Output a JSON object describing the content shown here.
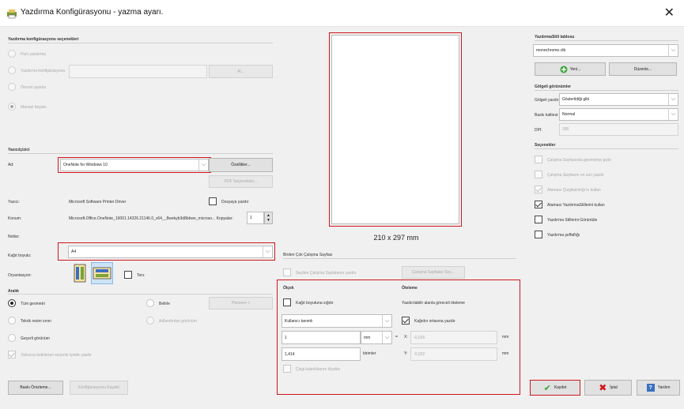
{
  "window": {
    "title": "Yazdırma Konfigürasyonu - yazma ayarı.",
    "close": "✕"
  },
  "config_section": {
    "title": "Yazdırma konfigürasyonu seçenekleri",
    "options": [
      "Hızlı yazdırma",
      "Yazdırma konfigürasyonu",
      "Önceki ayarlar",
      "Manuel beyanı"
    ],
    "selected": "Manuel beyanı",
    "name_field": "",
    "add_button": "Al..."
  },
  "printer": {
    "title": "Yazıcı/çizici",
    "name_label": "Ad:",
    "name_value": "OneNote for Windows 10",
    "properties_button": "Özellikler...",
    "pdf_button": "PDF Seçenekleri...",
    "plotter_label": "Yazıcı:",
    "plotter_value": "Microsoft Software Printer Driver",
    "print_to_file": "Dosyaya yazdır",
    "location_label": "Konum:",
    "location_value": "Microsoft.Office.OneNote_16001.14326.21146.0_x64__8wekyb3d8bbwe_microso... Kopyalar:",
    "copies": "1",
    "notes_label": "Notlar:"
  },
  "paper_size": {
    "label": "Kağıt boyutu:",
    "value": "A4"
  },
  "orientation": {
    "label": "Oryantasyon:",
    "reverse": "Ters"
  },
  "range": {
    "title": "Aralık",
    "options": [
      "Tüm geometri",
      "Tekrik resim sınırı",
      "Geçerli görünüm",
      "Belirle",
      "Adlandırılan görünüm"
    ],
    "selected": "Tüm geometri",
    "window_button": "Pencere <",
    "only_selected": "Yalnızca belirlenen seçenle içinde yazdır"
  },
  "preview": {
    "size_text": "210 x 297 mm"
  },
  "multi_sheet": {
    "title": "Birden Çok Çalışma Sayfası",
    "selected_sheets": "Seçilen Çalışma Sayfalarını yazdır",
    "select_button": "Çalışma Sayfaları Seç..."
  },
  "scale": {
    "title": "Ölçek",
    "fit": "Kağıt boyutuna sığdır",
    "custom": "Kullanıcı tanımlı",
    "value1": "1",
    "unit": "mm",
    "eq": "=",
    "value2": "1,414",
    "unit2": "birimler",
    "lineweights": "Çizgi kalınlıklarını ölçekle"
  },
  "offset": {
    "title": "Öteleme",
    "subtitle": "Yazdırılabilir alanla göreceli öteleme",
    "center": "Kağıdın ortasına yazdır",
    "x_label": "X:",
    "x_value": "-0,015",
    "y_label": "Y:",
    "y_value": "-0,022",
    "unit": "mm"
  },
  "style_table": {
    "title": "YazdırmaStili tablosu",
    "value": "monochrome.ctb",
    "new_button": "Yeni...",
    "edit_button": "Düzenle..."
  },
  "shaded": {
    "title": "Gölgeli görünümler",
    "print_label": "Gölgeli yazdır:",
    "print_value": "Gösterildiği gibi",
    "quality_label": "Baskı kalitesi:",
    "quality_value": "Normal",
    "dpi_label": "DPI:",
    "dpi_value": "300"
  },
  "options": {
    "title": "Seçenekler",
    "items": [
      {
        "label": "Çalışma Sayfasında geometriyi gizle",
        "checked": false,
        "disabled": true
      },
      {
        "label": "Çalışma Sayfasını en son yazdır",
        "checked": false,
        "disabled": true
      },
      {
        "label": "Ataması Çizgikalınlığı'nı kullan",
        "checked": true,
        "disabled": true
      },
      {
        "label": "Ataması YazdırmaStillerini kullan",
        "checked": true,
        "disabled": false
      },
      {
        "label": "Yazdırma Stillerini Görüntüle",
        "checked": false,
        "disabled": false
      },
      {
        "label": "Yazdırma şeffaflığı",
        "checked": false,
        "disabled": false
      }
    ]
  },
  "footer": {
    "preview_button": "Baskı Önizleme...",
    "save_config_button": "Konfigürasyonu Kaydet",
    "ok_button": "Kaydet",
    "cancel_button": "İptal",
    "help_button": "Yardım"
  },
  "colors": {
    "red_highlight": "#d0161d",
    "ok_green": "#3aa33a",
    "cancel_red": "#d0161d",
    "help_blue": "#3b6fbf"
  }
}
